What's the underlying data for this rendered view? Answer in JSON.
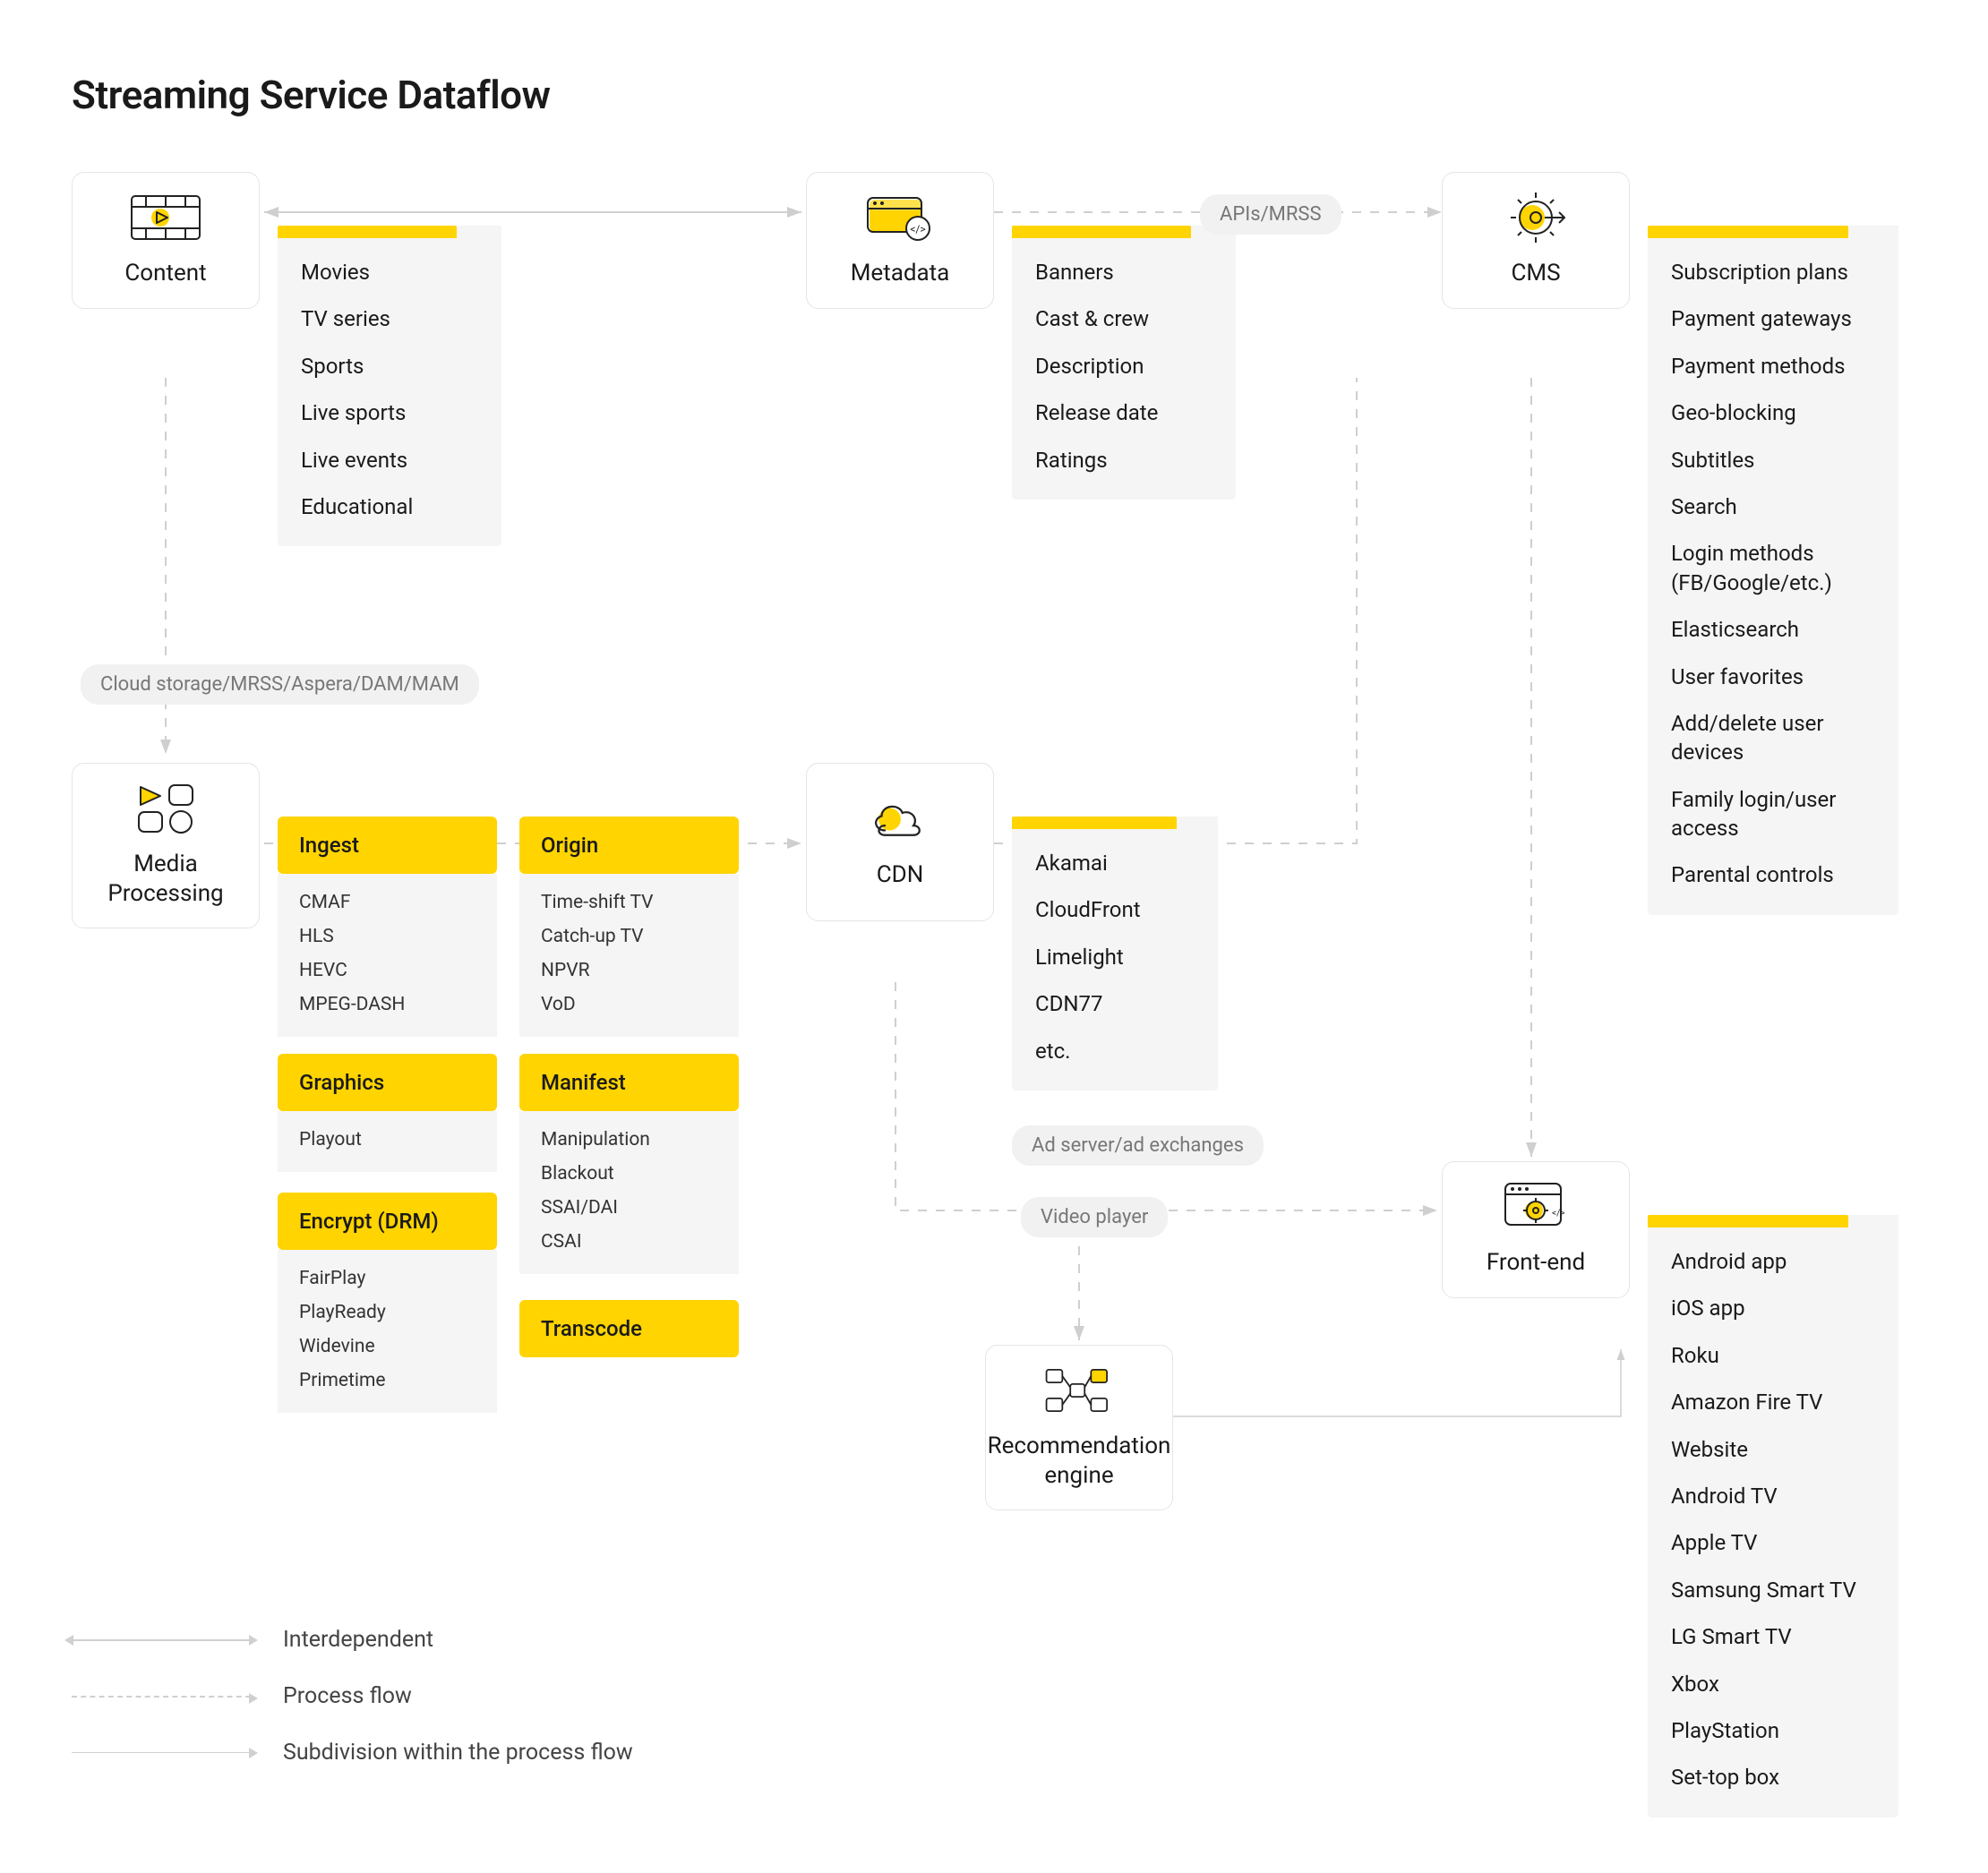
{
  "title": "Streaming Service Dataflow",
  "nodes": {
    "content": {
      "label": "Content",
      "items": [
        "Movies",
        "TV series",
        "Sports",
        "Live sports",
        "Live events",
        "Educational"
      ]
    },
    "metadata": {
      "label": "Metadata",
      "items": [
        "Banners",
        "Cast & crew",
        "Description",
        "Release date",
        "Ratings"
      ]
    },
    "cms": {
      "label": "CMS",
      "items": [
        "Subscription plans",
        "Payment gateways",
        "Payment methods",
        "Geo-blocking",
        "Subtitles",
        "Search",
        "Login methods (FB/Google/etc.)",
        "Elasticsearch",
        "User favorites",
        "Add/delete user devices",
        "Family login/user access",
        "Parental controls"
      ]
    },
    "media_processing": {
      "label": "Media Processing"
    },
    "cdn": {
      "label": "CDN",
      "items": [
        "Akamai",
        "CloudFront",
        "Limelight",
        "CDN77",
        "etc."
      ]
    },
    "frontend": {
      "label": "Front-end",
      "items": [
        "Android app",
        "iOS app",
        "Roku",
        "Amazon Fire TV",
        "Website",
        "Android TV",
        "Apple TV",
        "Samsung Smart TV",
        "LG Smart TV",
        "Xbox",
        "PlayStation",
        "Set-top box"
      ]
    },
    "recommendation": {
      "label": "Recommendation engine"
    }
  },
  "subgroups": {
    "ingest": {
      "title": "Ingest",
      "items": [
        "CMAF",
        "HLS",
        "HEVC",
        "MPEG-DASH"
      ]
    },
    "origin": {
      "title": "Origin",
      "items": [
        "Time-shift TV",
        "Catch-up TV",
        "NPVR",
        "VoD"
      ]
    },
    "graphics": {
      "title": "Graphics",
      "items": [
        "Playout"
      ]
    },
    "manifest": {
      "title": "Manifest",
      "items": [
        "Manipulation",
        "Blackout",
        "SSAI/DAI",
        "CSAI"
      ]
    },
    "encrypt": {
      "title": "Encrypt (DRM)",
      "items": [
        "FairPlay",
        "PlayReady",
        "Widevine",
        "Primetime"
      ]
    },
    "transcode": {
      "title": "Transcode",
      "items": []
    }
  },
  "floating": {
    "apis_mrss": "APIs/MRSS",
    "cloud_storage": "Cloud storage/MRSS/Aspera/DAM/MAM",
    "ad_server": "Ad server/ad exchanges",
    "video_player": "Video player"
  },
  "legend": {
    "interdependent": "Interdependent",
    "process_flow": "Process flow",
    "subdivision": "Subdivision within the process flow"
  }
}
